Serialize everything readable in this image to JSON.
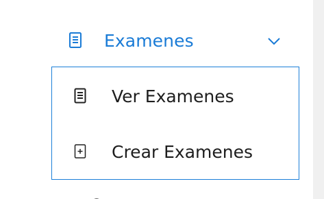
{
  "sidebar": {
    "section": {
      "label": "Examenes",
      "icon": "document-icon",
      "expanded": true,
      "expand_icon": "chevron-down-icon"
    },
    "items": [
      {
        "label": "Ver Examenes",
        "icon": "document-icon"
      },
      {
        "label": "Crear Examenes",
        "icon": "plus-square-icon"
      }
    ]
  },
  "colors": {
    "accent": "#1a7bd6",
    "border": "#1b7fd8",
    "text": "#1e1e1e"
  }
}
